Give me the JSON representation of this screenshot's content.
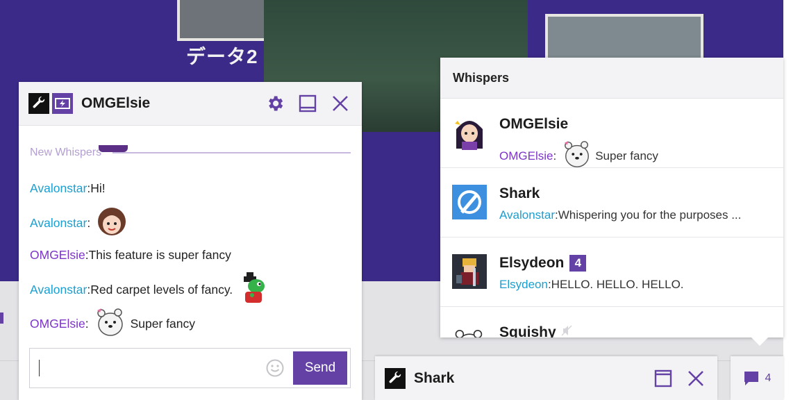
{
  "stream": {
    "overlay_text": "データ2"
  },
  "chat_window": {
    "title": "OMGElsie",
    "divider_label": "New Whispers",
    "messages": [
      {
        "user": "Avalonstar",
        "sep": ": ",
        "text": "Hi!",
        "emote": ""
      },
      {
        "user": "Avalonstar",
        "sep": ":",
        "text": "",
        "emote": "girl-face-emote"
      },
      {
        "user": "OMGElsie",
        "sep": ": ",
        "text": "This feature is super fancy",
        "emote": ""
      },
      {
        "user": "Avalonstar",
        "sep": ": ",
        "text": "Red carpet levels of fancy.",
        "emote": "yoshi-emote"
      },
      {
        "user": "OMGElsie",
        "sep": ":",
        "text": "Super fancy",
        "emote": "polar-bear-emote"
      }
    ],
    "input": {
      "value": "",
      "placeholder": ""
    },
    "send_label": "Send",
    "colors": {
      "accent": "#6441a4",
      "user_blue": "#1a9fd0",
      "user_purple": "#7d35c7"
    }
  },
  "whispers": {
    "title": "Whispers",
    "items": [
      {
        "name": "OMGElsie",
        "badge": "",
        "from": "OMGElsie",
        "sep": ":",
        "text": "Super fancy",
        "avatar": "anime-girl-avatar"
      },
      {
        "name": "Shark",
        "badge": "",
        "from": "Avalonstar",
        "sep": ": ",
        "text": "Whispering you for the purposes ...",
        "avatar": "shark-logo-avatar"
      },
      {
        "name": "Elsydeon",
        "badge": "4",
        "from": "Elsydeon",
        "sep": ": ",
        "text": "HELLO. HELLO. HELLO.",
        "avatar": "pixel-knight-avatar"
      },
      {
        "name": "Squishy",
        "badge": "",
        "from": "",
        "sep": "",
        "text": "",
        "avatar": "bear-avatar"
      }
    ]
  },
  "minimized_window": {
    "title": "Shark"
  },
  "whisper_toggle": {
    "count": "4",
    "icon": "speech-bubble-icon"
  }
}
